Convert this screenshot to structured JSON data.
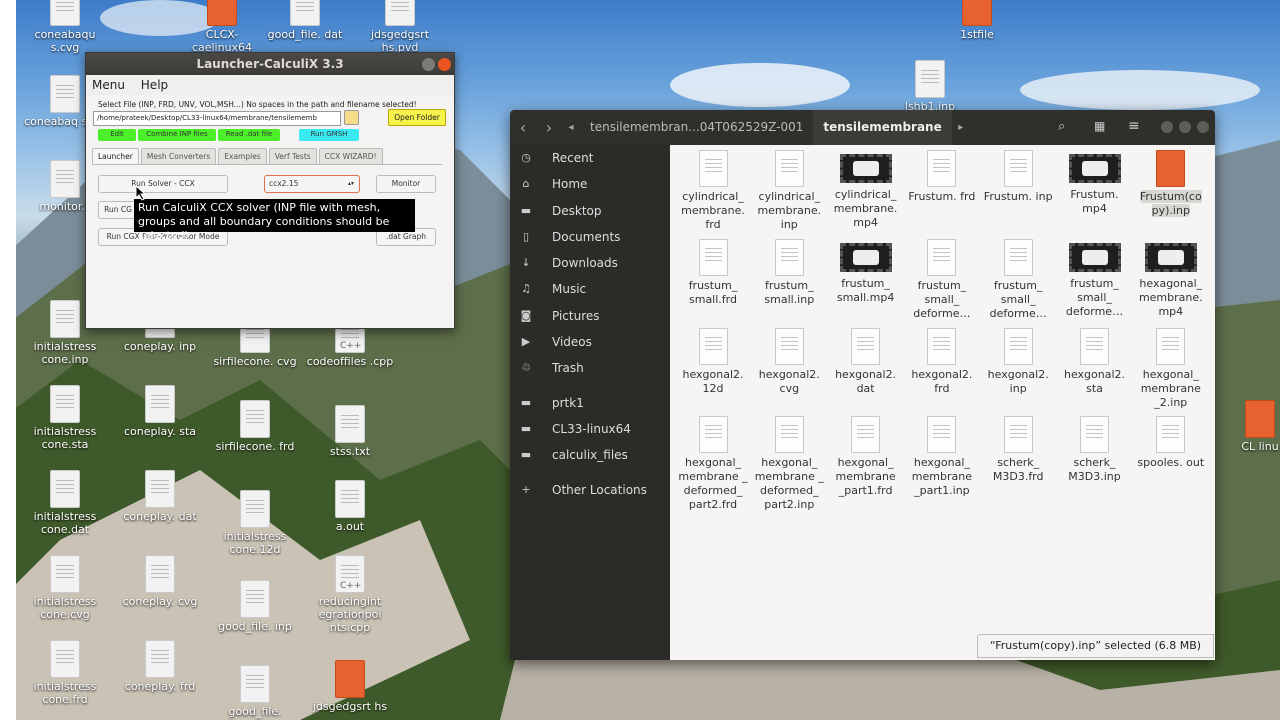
{
  "desktop": {
    "icons": [
      {
        "label": "coneabaqu s.cvg",
        "type": "doc"
      },
      {
        "label": "CLCX- caelinux64",
        "type": "orange"
      },
      {
        "label": "good_file. dat",
        "type": "doc"
      },
      {
        "label": "jdsgedgsrt hs.pvd",
        "type": "doc"
      },
      {
        "label": "1stfile",
        "type": "orange"
      },
      {
        "label": "coneabaq s.frd",
        "type": "doc"
      },
      {
        "label": "monitor.s",
        "type": "doc"
      },
      {
        "label": "initialstress cone.inp",
        "type": "doc"
      },
      {
        "label": "coneplay. inp",
        "type": "doc"
      },
      {
        "label": "sirfilecone. cvg",
        "type": "doc"
      },
      {
        "label": "codeoffiles .cpp",
        "type": "cpp"
      },
      {
        "label": "initialstress cone.sta",
        "type": "doc"
      },
      {
        "label": "coneplay. sta",
        "type": "doc"
      },
      {
        "label": "sirfilecone. frd",
        "type": "doc"
      },
      {
        "label": "stss.txt",
        "type": "doc"
      },
      {
        "label": "initialstress cone.dat",
        "type": "doc"
      },
      {
        "label": "coneplay. dat",
        "type": "doc"
      },
      {
        "label": "initialstress cone.12d",
        "type": "doc"
      },
      {
        "label": "a.out",
        "type": "doc"
      },
      {
        "label": "initialstress cone.cvg",
        "type": "doc"
      },
      {
        "label": "coneplay. cvg",
        "type": "doc"
      },
      {
        "label": "good_file. inp",
        "type": "doc"
      },
      {
        "label": "reducingint egrationpoi nts.cpp",
        "type": "cpp"
      },
      {
        "label": "initialstress cone.frd",
        "type": "doc"
      },
      {
        "label": "coneplay. frd",
        "type": "doc"
      },
      {
        "label": "good_file.",
        "type": "doc"
      },
      {
        "label": "jdsgedgsrt hs",
        "type": "orange"
      },
      {
        "label": "lshb1.inp",
        "type": "doc"
      },
      {
        "label": "CL linu",
        "type": "orange"
      }
    ]
  },
  "launcher": {
    "title": "Launcher-CalculiX 3.3",
    "menu": [
      "Menu",
      "Help"
    ],
    "instruction": "Select File (INP, FRD, UNV, VOL,MSH...) No spaces in the path and filename selected!",
    "path_value": "/home/prateek/Desktop/CL33-linux64/membrane/tensilememb",
    "open_folder": "Open Folder",
    "green_buttons": [
      "Edit",
      "Combine INP files",
      "Read .dat file"
    ],
    "run_gmsh": "Run GMSH",
    "tabs": [
      "Launcher",
      "Mesh Converters",
      "Examples",
      "Verf Tests",
      "CCX WIZARD!"
    ],
    "run_solver": "Run Solver - CCX",
    "solver_version": "ccx2.15",
    "monitor": "Monitor",
    "run_cgx_partial": "Run CG",
    "run_cgx_post": "Run CGX Post-Processor Mode",
    "dat_graph": ".dat Graph",
    "tooltip": "Run CalculiX CCX solver (INP file with mesh, groups and all boundary conditions should be selected)",
    "colors": {
      "green": "#4cef2a",
      "cyan": "#3ae8f0",
      "yellow": "#f5f24a"
    }
  },
  "files": {
    "breadcrumbs": [
      "tensilemembran...04T062529Z-001",
      "tensilemembrane"
    ],
    "sidebar": [
      {
        "label": "Recent",
        "icon": "clock-icon",
        "glyph": "◷"
      },
      {
        "label": "Home",
        "icon": "home-icon",
        "glyph": "⌂"
      },
      {
        "label": "Desktop",
        "icon": "folder-icon",
        "glyph": "▬"
      },
      {
        "label": "Documents",
        "icon": "document-icon",
        "glyph": "▯"
      },
      {
        "label": "Downloads",
        "icon": "download-icon",
        "glyph": "↓"
      },
      {
        "label": "Music",
        "icon": "music-icon",
        "glyph": "♫"
      },
      {
        "label": "Pictures",
        "icon": "camera-icon",
        "glyph": "◙"
      },
      {
        "label": "Videos",
        "icon": "video-icon",
        "glyph": "▶"
      },
      {
        "label": "Trash",
        "icon": "trash-icon",
        "glyph": "♲"
      },
      {
        "label": "prtk1",
        "icon": "folder-icon",
        "glyph": "▬"
      },
      {
        "label": "CL33-linux64",
        "icon": "folder-icon",
        "glyph": "▬"
      },
      {
        "label": "calculix_files",
        "icon": "folder-icon",
        "glyph": "▬"
      },
      {
        "label": "Other Locations",
        "icon": "plus-icon",
        "glyph": "+"
      }
    ],
    "grid": [
      {
        "label": "cylindrical_ membrane. frd",
        "type": "doc"
      },
      {
        "label": "cylindrical_ membrane. inp",
        "type": "doc"
      },
      {
        "label": "cylindrical_ membrane. mp4",
        "type": "vid"
      },
      {
        "label": "Frustum. frd",
        "type": "doc"
      },
      {
        "label": "Frustum. inp",
        "type": "doc"
      },
      {
        "label": "Frustum. mp4",
        "type": "vid"
      },
      {
        "label": "Frustum(co py).inp",
        "type": "orange",
        "selected": true
      },
      {
        "label": "frustum_ small.frd",
        "type": "doc"
      },
      {
        "label": "frustum_ small.inp",
        "type": "doc"
      },
      {
        "label": "frustum_ small.mp4",
        "type": "vid"
      },
      {
        "label": "frustum_ small_ deforme…",
        "type": "doc"
      },
      {
        "label": "frustum_ small_ deforme…",
        "type": "doc"
      },
      {
        "label": "frustum_ small_ deforme…",
        "type": "vid"
      },
      {
        "label": "hexagonal_ membrane. mp4",
        "type": "vid"
      },
      {
        "label": "hexgonal2. 12d",
        "type": "doc"
      },
      {
        "label": "hexgonal2. cvg",
        "type": "doc"
      },
      {
        "label": "hexgonal2. dat",
        "type": "doc"
      },
      {
        "label": "hexgonal2. frd",
        "type": "doc"
      },
      {
        "label": "hexgonal2. inp",
        "type": "doc"
      },
      {
        "label": "hexgonal2. sta",
        "type": "doc"
      },
      {
        "label": "hexgonal_ membrane _2.inp",
        "type": "doc"
      },
      {
        "label": "hexgonal_ membrane _ deformed_ part2.frd",
        "type": "doc"
      },
      {
        "label": "hexgonal_ membrane _ deformed_ part2.inp",
        "type": "doc"
      },
      {
        "label": "hexgonal_ membrane _part1.frd",
        "type": "doc"
      },
      {
        "label": "hexgonal_ membrane _part1.inp",
        "type": "doc"
      },
      {
        "label": "scherk_ M3D3.frd",
        "type": "doc"
      },
      {
        "label": "scherk_ M3D3.inp",
        "type": "doc"
      },
      {
        "label": "spooles. out",
        "type": "doc"
      }
    ],
    "status": "“Frustum(copy).inp” selected (6.8 MB)"
  }
}
